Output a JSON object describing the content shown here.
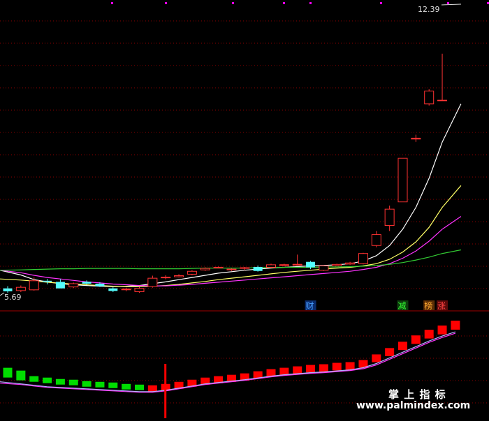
{
  "chart_data": {
    "type": "candlestick",
    "price_labels": {
      "high": "12.39",
      "low": "5.69"
    },
    "candles": [
      {
        "o": 5.82,
        "h": 5.88,
        "l": 5.7,
        "c": 5.74
      },
      {
        "o": 5.76,
        "h": 5.9,
        "l": 5.72,
        "c": 5.85
      },
      {
        "o": 5.78,
        "h": 6.12,
        "l": 5.76,
        "c": 6.03
      },
      {
        "o": 6.03,
        "h": 6.08,
        "l": 5.93,
        "c": 6.0
      },
      {
        "o": 6.0,
        "h": 6.08,
        "l": 5.82,
        "c": 5.82
      },
      {
        "o": 5.86,
        "h": 5.98,
        "l": 5.83,
        "c": 5.95
      },
      {
        "o": 6.0,
        "h": 6.04,
        "l": 5.93,
        "c": 5.95
      },
      {
        "o": 5.95,
        "h": 5.99,
        "l": 5.86,
        "c": 5.88
      },
      {
        "o": 5.82,
        "h": 5.85,
        "l": 5.72,
        "c": 5.75
      },
      {
        "o": 5.8,
        "h": 5.84,
        "l": 5.74,
        "c": 5.8
      },
      {
        "o": 5.73,
        "h": 5.86,
        "l": 5.7,
        "c": 5.82
      },
      {
        "o": 5.87,
        "h": 6.17,
        "l": 5.84,
        "c": 6.1
      },
      {
        "o": 6.11,
        "h": 6.18,
        "l": 6.07,
        "c": 6.13
      },
      {
        "o": 6.14,
        "h": 6.21,
        "l": 6.12,
        "c": 6.17
      },
      {
        "o": 6.21,
        "h": 6.32,
        "l": 6.18,
        "c": 6.29
      },
      {
        "o": 6.33,
        "h": 6.4,
        "l": 6.3,
        "c": 6.37
      },
      {
        "o": 6.4,
        "h": 6.42,
        "l": 6.38,
        "c": 6.4
      },
      {
        "o": 6.33,
        "h": 6.37,
        "l": 6.3,
        "c": 6.35
      },
      {
        "o": 6.37,
        "h": 6.41,
        "l": 6.32,
        "c": 6.39
      },
      {
        "o": 6.41,
        "h": 6.45,
        "l": 6.28,
        "c": 6.3
      },
      {
        "o": 6.4,
        "h": 6.5,
        "l": 6.38,
        "c": 6.47
      },
      {
        "o": 6.47,
        "h": 6.5,
        "l": 6.44,
        "c": 6.47
      },
      {
        "o": 6.48,
        "h": 6.75,
        "l": 6.45,
        "c": 6.48
      },
      {
        "o": 6.55,
        "h": 6.58,
        "l": 6.35,
        "c": 6.4
      },
      {
        "o": 6.32,
        "h": 6.45,
        "l": 6.3,
        "c": 6.44
      },
      {
        "o": 6.45,
        "h": 6.5,
        "l": 6.43,
        "c": 6.48
      },
      {
        "o": 6.49,
        "h": 6.55,
        "l": 6.47,
        "c": 6.52
      },
      {
        "o": 6.5,
        "h": 6.8,
        "l": 6.48,
        "c": 6.78
      },
      {
        "o": 7.0,
        "h": 7.4,
        "l": 6.95,
        "c": 7.3
      },
      {
        "o": 7.55,
        "h": 8.1,
        "l": 7.4,
        "c": 8.0
      },
      {
        "o": 8.2,
        "h": 9.4,
        "l": 8.2,
        "c": 9.4
      },
      {
        "o": 9.95,
        "h": 10.05,
        "l": 9.85,
        "c": 9.95
      },
      {
        "o": 10.9,
        "h": 11.3,
        "l": 10.85,
        "c": 11.25
      },
      {
        "o": 11.0,
        "h": 12.28,
        "l": 11.0,
        "c": 11.0
      }
    ],
    "ma_lines": [
      {
        "color": "#ffffff",
        "values": [
          6.32,
          6.19,
          6.06,
          6.0,
          5.95,
          5.92,
          5.9,
          5.88,
          5.87,
          5.88,
          5.9,
          5.95,
          6.0,
          6.06,
          6.12,
          6.18,
          6.24,
          6.28,
          6.32,
          6.35,
          6.38,
          6.4,
          6.42,
          6.44,
          6.45,
          6.47,
          6.5,
          6.57,
          6.72,
          7.0,
          7.45,
          8.05,
          8.85,
          9.85,
          10.9
        ]
      },
      {
        "color": "#ffff66",
        "values": [
          6.08,
          6.05,
          6.02,
          5.99,
          5.96,
          5.94,
          5.92,
          5.9,
          5.88,
          5.87,
          5.87,
          5.88,
          5.9,
          5.93,
          5.97,
          6.01,
          6.06,
          6.1,
          6.14,
          6.18,
          6.22,
          6.26,
          6.29,
          6.32,
          6.35,
          6.38,
          6.4,
          6.44,
          6.5,
          6.62,
          6.82,
          7.1,
          7.5,
          8.05,
          8.65
        ]
      },
      {
        "color": "#ff33ff",
        "values": [
          6.32,
          6.25,
          6.18,
          6.12,
          6.08,
          6.04,
          6.0,
          5.97,
          5.94,
          5.92,
          5.9,
          5.89,
          5.89,
          5.91,
          5.93,
          5.96,
          5.99,
          6.02,
          6.05,
          6.08,
          6.11,
          6.14,
          6.17,
          6.2,
          6.23,
          6.26,
          6.29,
          6.34,
          6.4,
          6.5,
          6.65,
          6.85,
          7.12,
          7.45,
          7.8
        ]
      },
      {
        "color": "#33cc33",
        "values": [
          6.32,
          6.33,
          6.34,
          6.35,
          6.36,
          6.36,
          6.37,
          6.37,
          6.37,
          6.37,
          6.36,
          6.36,
          6.36,
          6.36,
          6.37,
          6.38,
          6.38,
          6.38,
          6.38,
          6.39,
          6.39,
          6.4,
          6.4,
          6.4,
          6.41,
          6.41,
          6.42,
          6.43,
          6.45,
          6.48,
          6.53,
          6.6,
          6.68,
          6.78,
          6.88
        ]
      }
    ],
    "signals": [
      {
        "label": "财",
        "candle": 23,
        "color": "#4a9fff",
        "bg": "#0a2c6e"
      },
      {
        "label": "减",
        "candle": 30,
        "color": "#33ff33",
        "bg": "#0d3d0d"
      },
      {
        "label": "榜",
        "candle": 32,
        "color": "#ffaa33",
        "bg": "#5c2e05"
      },
      {
        "label": "涨",
        "candle": 33,
        "color": "#ff4444",
        "bg": "#5c0a0a"
      }
    ],
    "indicator": {
      "bars": [
        4.2,
        3.8,
        3.4,
        3.2,
        3.0,
        2.9,
        2.7,
        2.6,
        2.5,
        2.3,
        2.2,
        2.1,
        2.3,
        2.6,
        2.9,
        3.2,
        3.4,
        3.6,
        3.8,
        4.1,
        4.4,
        4.6,
        4.8,
        5.0,
        5.1,
        5.3,
        5.4,
        5.7,
        6.5,
        7.4,
        8.3,
        9.2,
        10.0,
        10.6,
        11.3
      ],
      "colors": [
        "g",
        "g",
        "g",
        "g",
        "g",
        "g",
        "g",
        "g",
        "g",
        "g",
        "g",
        "r",
        "r",
        "r",
        "r",
        "r",
        "r",
        "r",
        "r",
        "r",
        "r",
        "r",
        "r",
        "r",
        "r",
        "r",
        "r",
        "r",
        "r",
        "r",
        "r",
        "r",
        "r",
        "r",
        "r"
      ],
      "line_white": [
        3.4,
        3.1,
        2.9,
        2.7,
        2.6,
        2.5,
        2.4,
        2.3,
        2.2,
        2.1,
        2.0,
        2.0,
        2.2,
        2.5,
        2.8,
        3.1,
        3.3,
        3.5,
        3.7,
        3.95,
        4.2,
        4.4,
        4.55,
        4.7,
        4.8,
        4.95,
        5.1,
        5.4,
        6.0,
        6.8,
        7.6,
        8.4,
        9.2,
        9.9,
        10.5
      ],
      "line_magenta": [
        3.2,
        3.0,
        2.8,
        2.6,
        2.5,
        2.4,
        2.3,
        2.2,
        2.1,
        2.0,
        1.9,
        1.9,
        2.1,
        2.4,
        2.7,
        3.0,
        3.2,
        3.4,
        3.6,
        3.85,
        4.1,
        4.3,
        4.45,
        4.6,
        4.7,
        4.85,
        5.0,
        5.25,
        5.8,
        6.6,
        7.4,
        8.2,
        9.0,
        9.7,
        10.3
      ],
      "spike_candle": 12,
      "spike_value": 6.3,
      "ylim": [
        -0.3,
        12.5
      ]
    }
  },
  "watermark": {
    "line1": "掌 上 指 标",
    "line2": "www.palmindex.com"
  },
  "colors": {
    "up": "#ff3232",
    "down": "#54ffff",
    "indicator_up": "#ff0000",
    "indicator_down": "#00dd00",
    "grid": "#8b0000",
    "dot": "#ff00ff"
  }
}
